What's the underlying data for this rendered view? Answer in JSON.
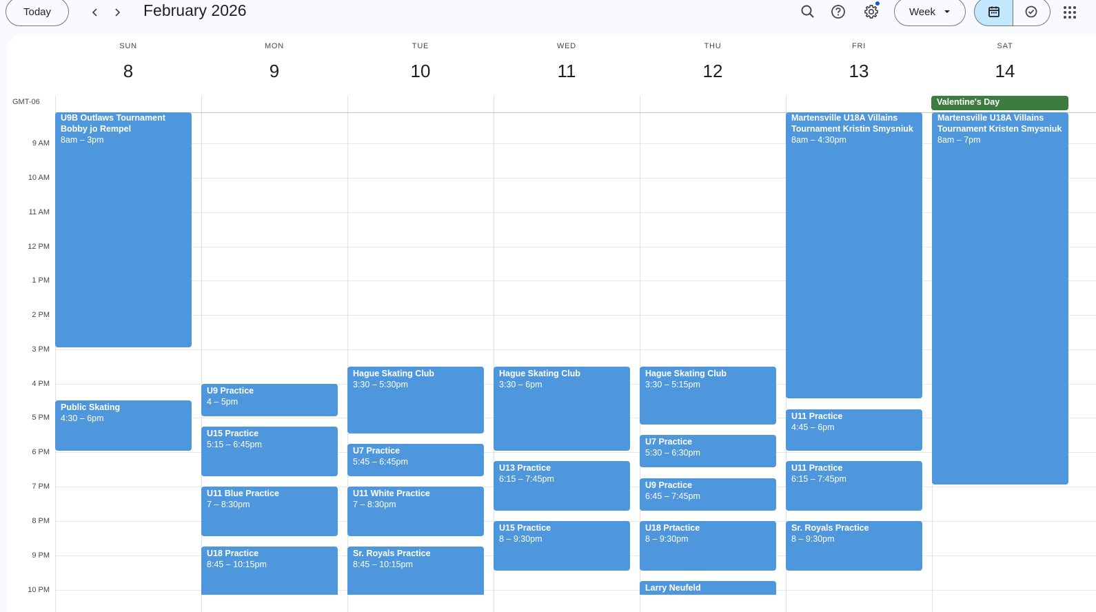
{
  "header": {
    "today_label": "Today",
    "prev_icon": "chevron-left-icon",
    "next_icon": "chevron-right-icon",
    "title": "February 2026",
    "view_label": "Week"
  },
  "timezone": "GMT-06",
  "days": [
    {
      "dow": "SUN",
      "num": "8"
    },
    {
      "dow": "MON",
      "num": "9"
    },
    {
      "dow": "TUE",
      "num": "10"
    },
    {
      "dow": "WED",
      "num": "11"
    },
    {
      "dow": "THU",
      "num": "12"
    },
    {
      "dow": "FRI",
      "num": "13"
    },
    {
      "dow": "SAT",
      "num": "14"
    }
  ],
  "time_labels": [
    "9 AM",
    "10 AM",
    "11 AM",
    "12 PM",
    "1 PM",
    "2 PM",
    "3 PM",
    "4 PM",
    "5 PM",
    "6 PM",
    "7 PM",
    "8 PM",
    "9 PM",
    "10 PM"
  ],
  "allday": {
    "title": "Valentine's Day",
    "color": "#3c7d3f"
  },
  "events": {
    "sun_tournament": {
      "title_line1": "U9B Outlaws Tournament",
      "title_line2": "Bobby jo Rempel",
      "time": "8am – 3pm"
    },
    "sun_public": {
      "title": "Public Skating",
      "time": "4:30 – 6pm"
    },
    "mon_u9": {
      "title": "U9 Practice",
      "time": "4 – 5pm"
    },
    "mon_u15": {
      "title": "U15 Practice",
      "time": "5:15 – 6:45pm"
    },
    "mon_u11blue": {
      "title": "U11 Blue Practice",
      "time": "7 – 8:30pm"
    },
    "mon_u18": {
      "title": "U18 Practice",
      "time": "8:45 – 10:15pm"
    },
    "tue_hague": {
      "title": "Hague Skating Club",
      "time": "3:30 – 5:30pm"
    },
    "tue_u7": {
      "title": "U7 Practice",
      "time": "5:45 – 6:45pm"
    },
    "tue_u11white": {
      "title": "U11 White Practice",
      "time": "7 – 8:30pm"
    },
    "tue_royals": {
      "title": "Sr. Royals Practice",
      "time": "8:45 – 10:15pm"
    },
    "wed_hague": {
      "title": "Hague Skating Club",
      "time": "3:30 – 6pm"
    },
    "wed_u13": {
      "title": "U13 Practice",
      "time": "6:15 – 7:45pm"
    },
    "wed_u15": {
      "title": "U15 Practice",
      "time": "8 – 9:30pm"
    },
    "thu_hague": {
      "title": "Hague Skating Club",
      "time": "3:30 – 5:15pm"
    },
    "thu_u7": {
      "title": "U7 Practice",
      "time": "5:30 – 6:30pm"
    },
    "thu_u9": {
      "title": "U9 Practice",
      "time": "6:45 – 7:45pm"
    },
    "thu_u18": {
      "title": "U18 Prtactice",
      "time": "8 – 9:30pm"
    },
    "thu_larry": {
      "title": "Larry Neufeld"
    },
    "fri_tournament": {
      "title_line1": "Martensville U18A Villains",
      "title_line2": "Tournament Kristin Smysniuk",
      "time": "8am – 4:30pm"
    },
    "fri_u11a": {
      "title": "U11 Practice",
      "time": "4:45 – 6pm"
    },
    "fri_u11b": {
      "title": "U11 Practice",
      "time": "6:15 – 7:45pm"
    },
    "fri_royals": {
      "title": "Sr. Royals Practice",
      "time": "8 – 9:30pm"
    },
    "sat_tournament": {
      "title_line1": "Martensville U18A Villains",
      "title_line2": "Tournament Kristen Smysniuk",
      "time": "8am – 7pm"
    }
  },
  "colors": {
    "event": "#4f97dd",
    "accent_selected": "#c2e7ff",
    "notification_dot": "#0b57d0"
  }
}
